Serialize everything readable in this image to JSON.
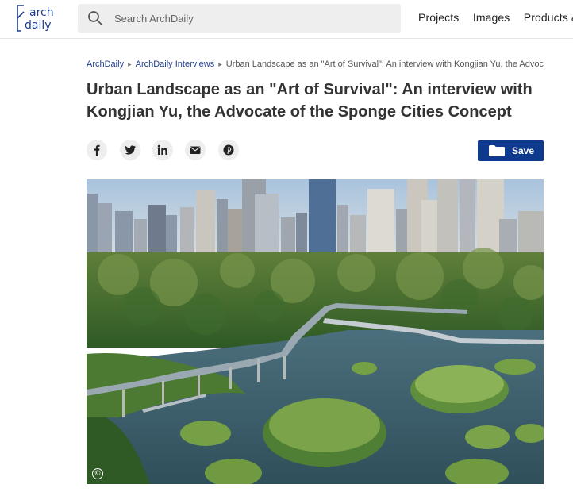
{
  "header": {
    "logo_line1": "arch",
    "logo_line2": "daily",
    "search_placeholder": "Search ArchDaily",
    "nav": [
      "Projects",
      "Images",
      "Products &"
    ]
  },
  "breadcrumb": {
    "items": [
      "ArchDaily",
      "ArchDaily Interviews"
    ],
    "current": "Urban Landscape as an \"Art of Survival\": An interview with Kongjian Yu, the Advoc"
  },
  "article": {
    "title": "Urban Landscape as an \"Art of Survival\": An interview with Kongjian Yu, the Advocate of the Sponge Cities Concept",
    "save_label": "Save",
    "copyright_symbol": "©"
  },
  "share_icons": [
    "facebook-icon",
    "twitter-icon",
    "linkedin-icon",
    "email-icon",
    "pinterest-icon"
  ],
  "colors": {
    "brand": "#0d3a8c",
    "link": "#1e3d8f",
    "title": "#333333"
  }
}
